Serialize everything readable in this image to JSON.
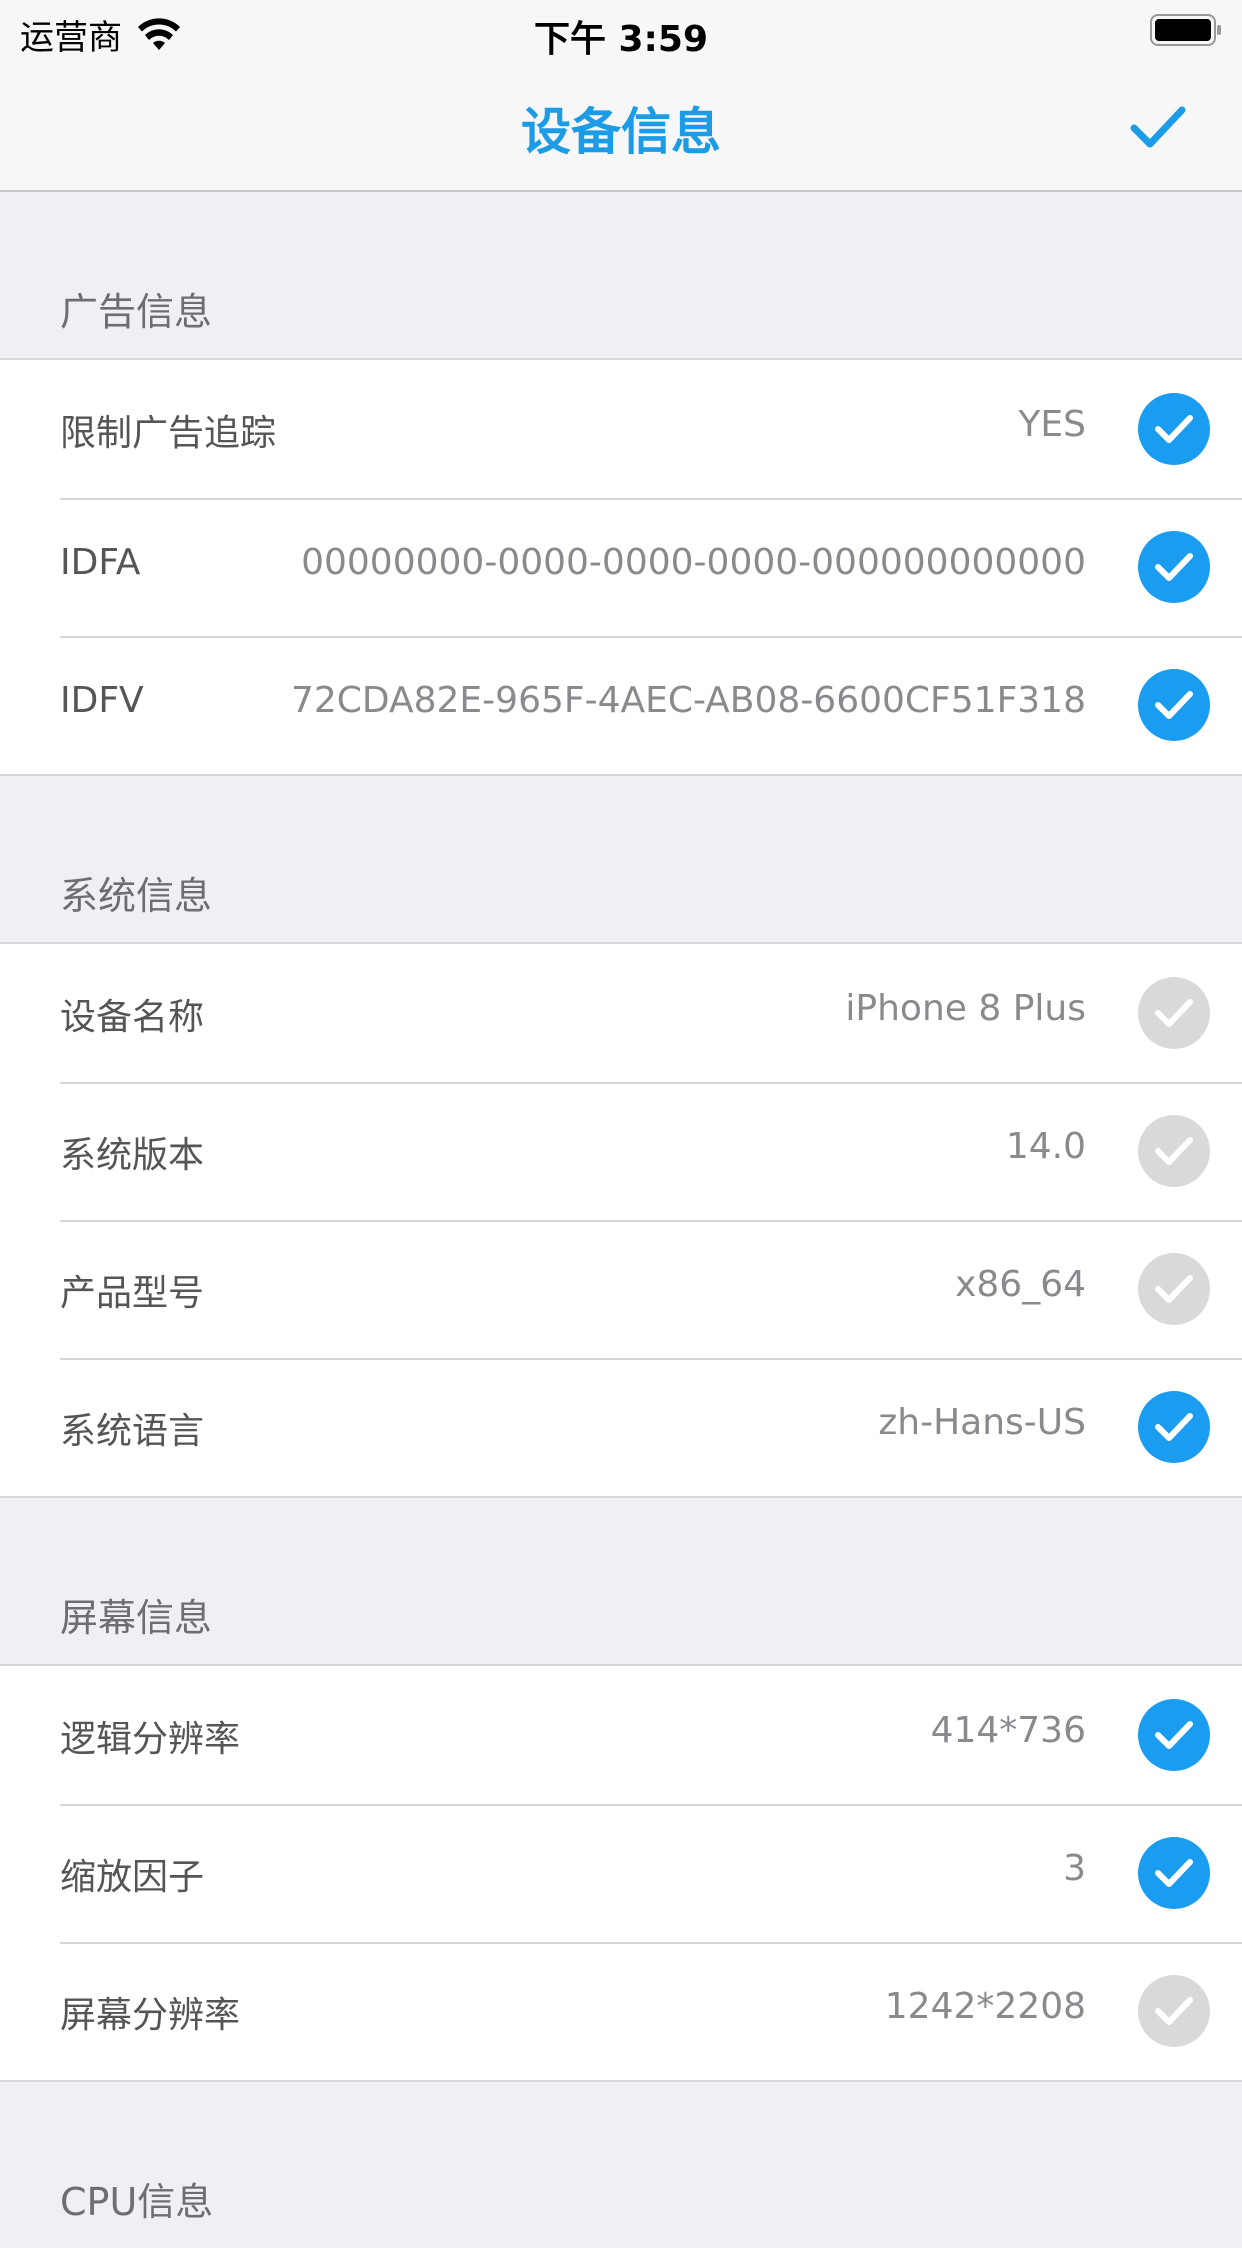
{
  "status_bar": {
    "carrier": "运营商",
    "time": "下午 3:59"
  },
  "nav": {
    "title": "设备信息"
  },
  "colors": {
    "accent": "#1c9be6",
    "check_on": "#1a9cf0",
    "check_off": "#d9d9d9"
  },
  "sections": [
    {
      "title": "广告信息",
      "rows": [
        {
          "label": "限制广告追踪",
          "value": "YES",
          "checked": true
        },
        {
          "label": "IDFA",
          "value": "00000000-0000-0000-0000-000000000000",
          "checked": true
        },
        {
          "label": "IDFV",
          "value": "72CDA82E-965F-4AEC-AB08-6600CF51F318",
          "checked": true
        }
      ]
    },
    {
      "title": "系统信息",
      "rows": [
        {
          "label": "设备名称",
          "value": "iPhone 8 Plus",
          "checked": false
        },
        {
          "label": "系统版本",
          "value": "14.0",
          "checked": false
        },
        {
          "label": "产品型号",
          "value": "x86_64",
          "checked": false
        },
        {
          "label": "系统语言",
          "value": "zh-Hans-US",
          "checked": true
        }
      ]
    },
    {
      "title": "屏幕信息",
      "rows": [
        {
          "label": "逻辑分辨率",
          "value": "414*736",
          "checked": true
        },
        {
          "label": "缩放因子",
          "value": "3",
          "checked": true
        },
        {
          "label": "屏幕分辨率",
          "value": "1242*2208",
          "checked": false
        }
      ]
    },
    {
      "title": "CPU信息",
      "rows": []
    }
  ]
}
